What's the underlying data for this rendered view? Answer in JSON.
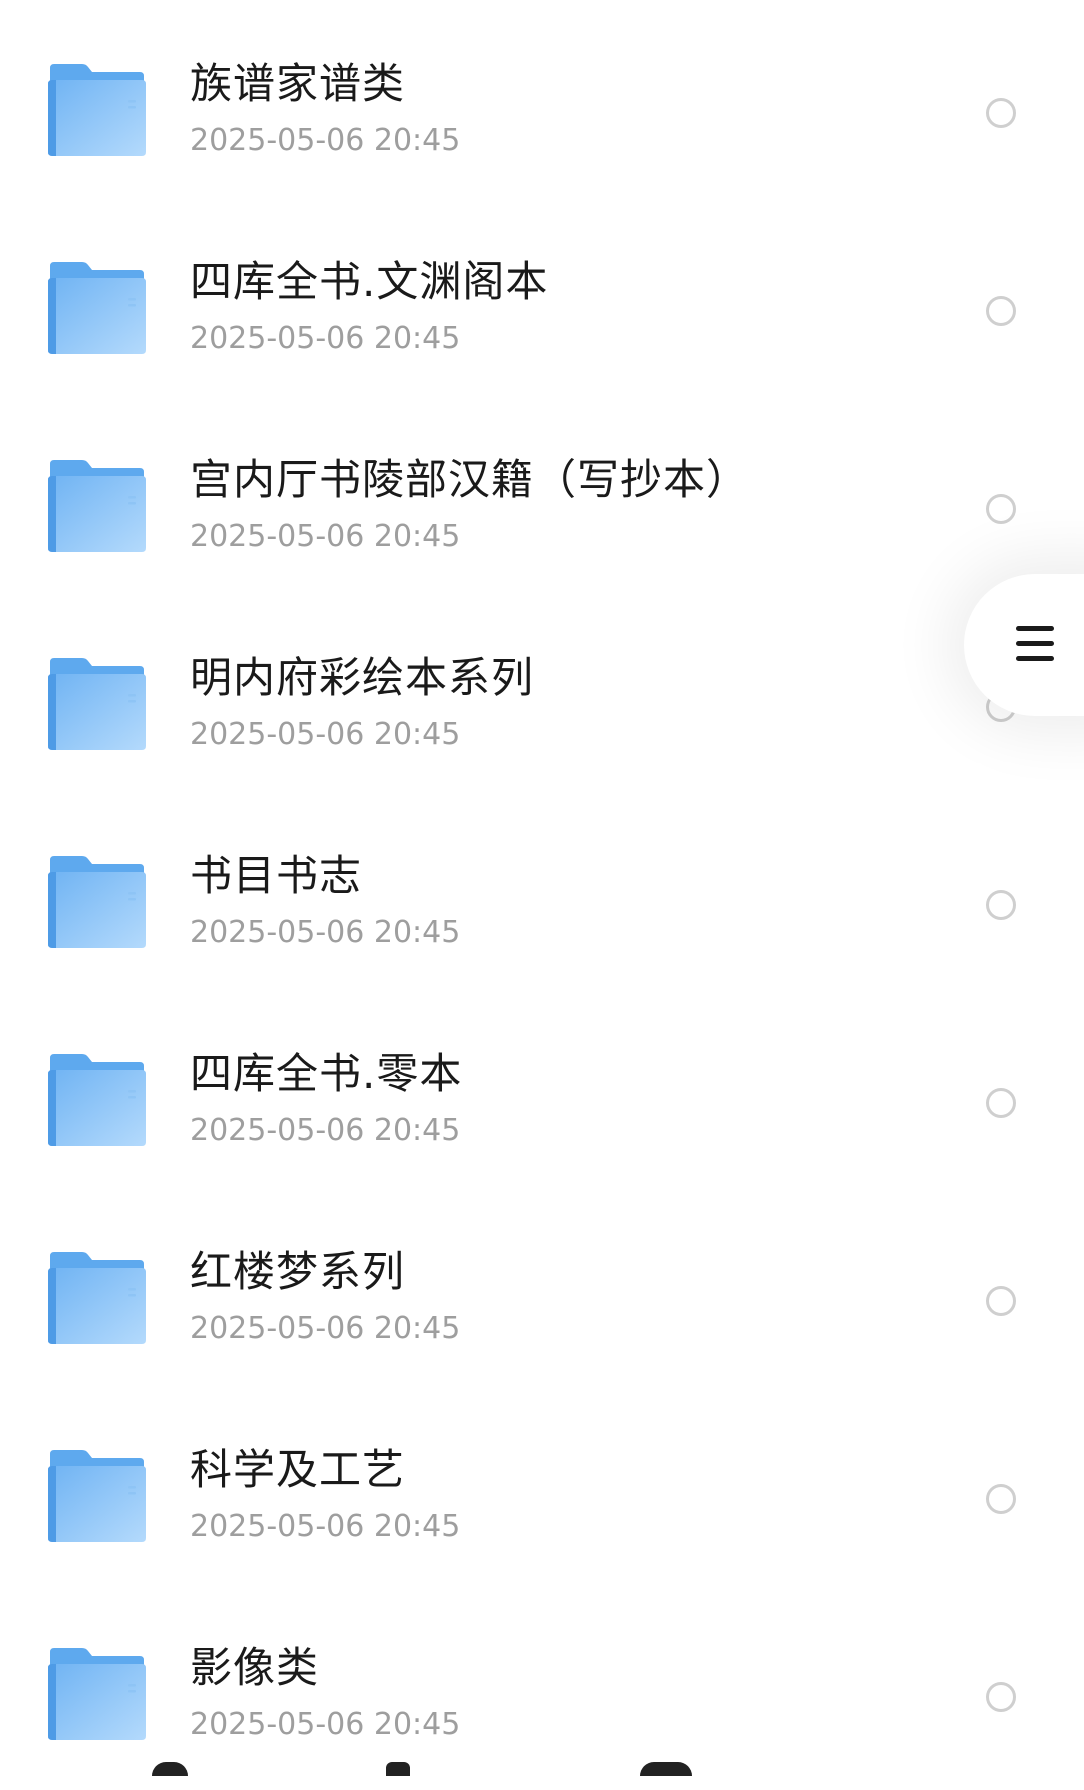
{
  "files": [
    {
      "name": "族谱家谱类",
      "date": "2025-05-06 20:45",
      "icon": "folder-icon"
    },
    {
      "name": "四库全书.文渊阁本",
      "date": "2025-05-06 20:45",
      "icon": "folder-icon"
    },
    {
      "name": "宫内厅书陵部汉籍（写抄本）",
      "date": "2025-05-06 20:45",
      "icon": "folder-icon"
    },
    {
      "name": "明内府彩绘本系列",
      "date": "2025-05-06 20:45",
      "icon": "folder-icon"
    },
    {
      "name": "书目书志",
      "date": "2025-05-06 20:45",
      "icon": "folder-icon"
    },
    {
      "name": "四库全书.零本",
      "date": "2025-05-06 20:45",
      "icon": "folder-icon"
    },
    {
      "name": "红楼梦系列",
      "date": "2025-05-06 20:45",
      "icon": "folder-icon"
    },
    {
      "name": "科学及工艺",
      "date": "2025-05-06 20:45",
      "icon": "folder-icon"
    },
    {
      "name": "影像类",
      "date": "2025-05-06 20:45",
      "icon": "folder-icon"
    }
  ],
  "floating_menu": {
    "icon": "menu-icon"
  },
  "colors": {
    "folder_light": "#aad4fb",
    "folder_dark": "#5ea9ee",
    "name_text": "#1a1a1a",
    "date_text": "#9e9e9e",
    "radio_border": "#cfcfcf"
  }
}
